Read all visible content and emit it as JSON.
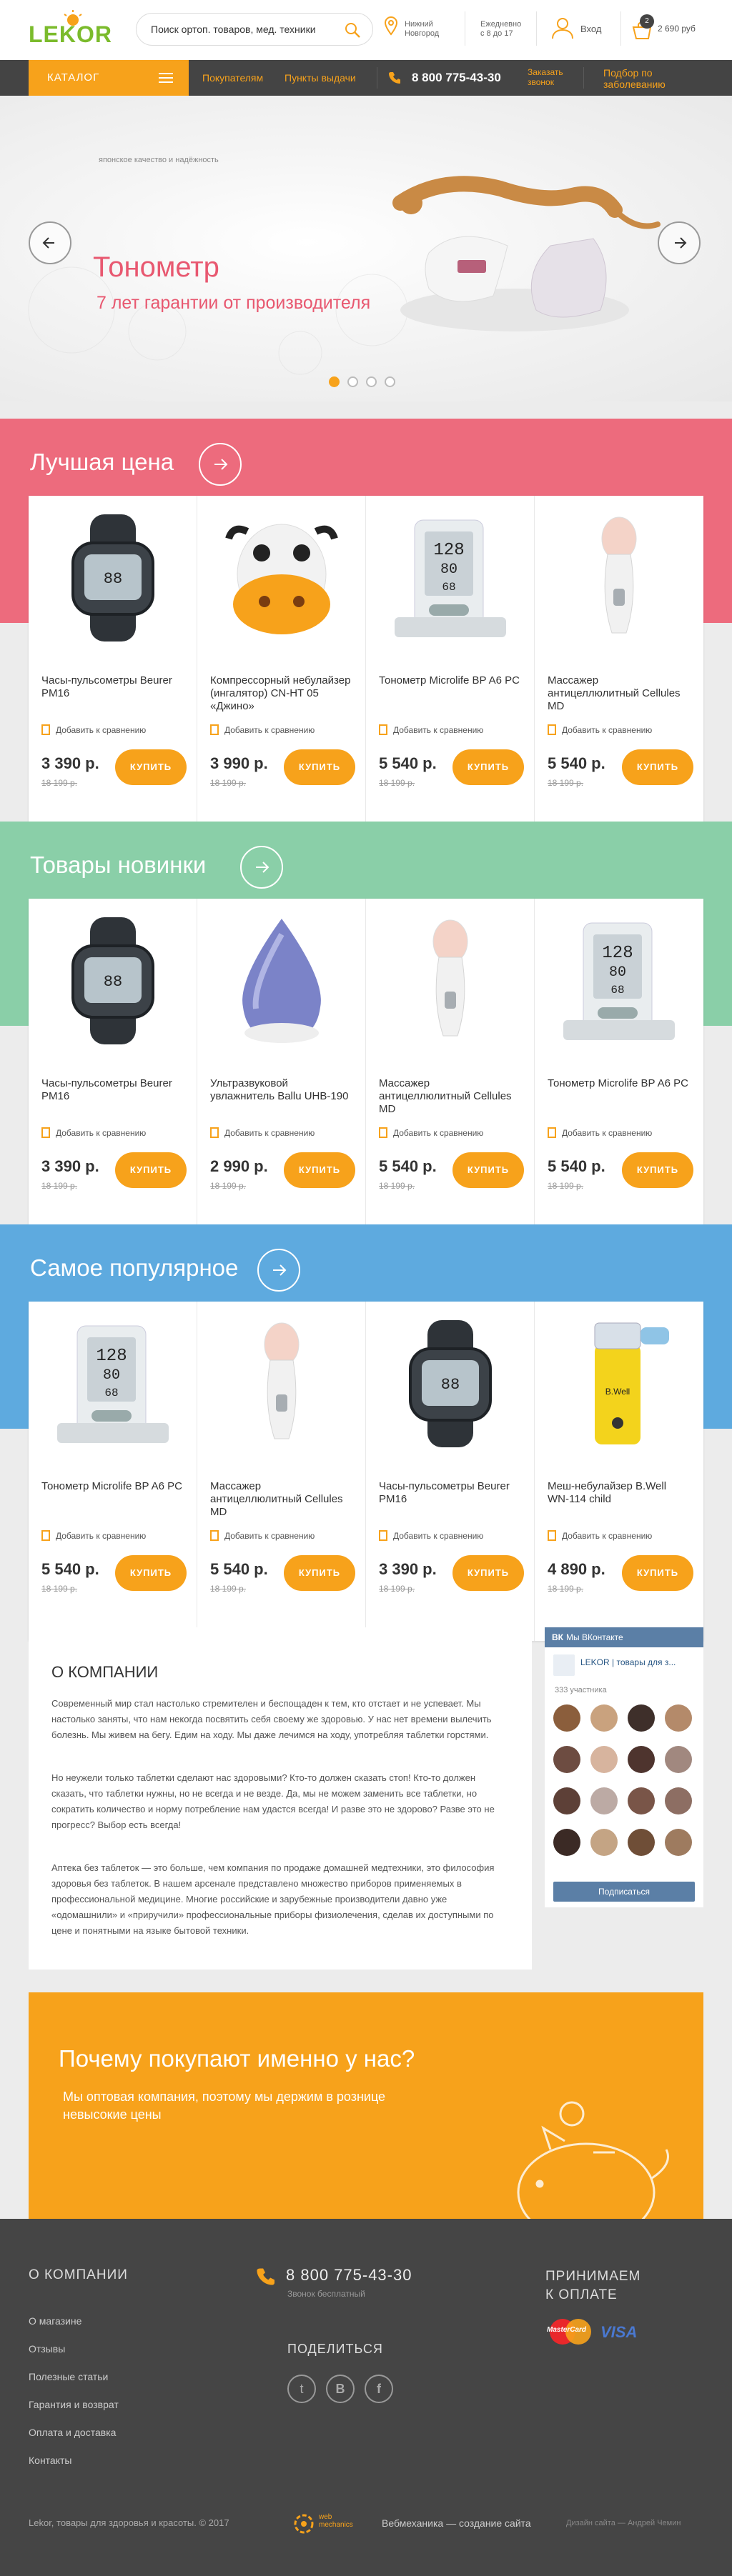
{
  "header": {
    "logo": "LEKOR",
    "search_placeholder": "Поиск ортоп. товаров, мед. техники",
    "city_line1": "Нижний",
    "city_line2": "Новгород",
    "hours_line1": "Ежедневно",
    "hours_line2": "с 8 до 17",
    "login": "Вход",
    "cart_count": "2",
    "cart_total": "2 690 руб"
  },
  "nav": {
    "catalog": "КАТАЛОГ",
    "buyers": "Покупателям",
    "pickup": "Пункты выдачи",
    "phone": "8 800 775-43-30",
    "callback_line1": "Заказать",
    "callback_line2": "звонок",
    "pick_line1": "Подбор по",
    "pick_line2": "заболеванию"
  },
  "hero": {
    "tagline": "японское качество и надёжность",
    "title": "Тонометр",
    "subtitle": "7 лет гарантии от производителя",
    "active_slide": 1,
    "slides": 4
  },
  "compare_label": "Добавить к сравнению",
  "buy_label": "КУПИТЬ",
  "sections": [
    {
      "title": "Лучшая цена",
      "color": "#ed6b7d",
      "products": [
        {
          "name": "Часы-пульсометры Beurer PM16",
          "price": "3 390 р.",
          "old": "18 199 р.",
          "icon": "watch"
        },
        {
          "name": "Компрессорный небулайзер (ингалятор) CN-HT 05 «Джино»",
          "price": "3 990 р.",
          "old": "18 199 р.",
          "icon": "cow-nebulizer"
        },
        {
          "name": "Тонометр Microlife BP A6 PC",
          "price": "5 540 р.",
          "old": "18 199 р.",
          "icon": "tonometer"
        },
        {
          "name": "Массажер антицеллюлитный Cellules MD",
          "price": "5 540 р.",
          "old": "18 199 р.",
          "icon": "massager"
        }
      ]
    },
    {
      "title": "Товары новинки",
      "color": "#8acfa8",
      "products": [
        {
          "name": "Часы-пульсометры Beurer PM16",
          "price": "3 390 р.",
          "old": "18 199 р.",
          "icon": "watch"
        },
        {
          "name": "Ультразвуковой увлажнитель Ballu UHB-190",
          "price": "2 990 р.",
          "old": "18 199 р.",
          "icon": "humidifier"
        },
        {
          "name": "Массажер антицеллюлитный Cellules MD",
          "price": "5 540 р.",
          "old": "18 199 р.",
          "icon": "massager"
        },
        {
          "name": "Тонометр Microlife BP A6 PC",
          "price": "5 540 р.",
          "old": "18 199 р.",
          "icon": "tonometer"
        }
      ]
    },
    {
      "title": "Самое популярное",
      "color": "#5eaadf",
      "products": [
        {
          "name": "Тонометр Microlife BP A6 PC",
          "price": "5 540 р.",
          "old": "18 199 р.",
          "icon": "tonometer"
        },
        {
          "name": "Массажер антицеллюлитный Cellules MD",
          "price": "5 540 р.",
          "old": "18 199 р.",
          "icon": "massager"
        },
        {
          "name": "Часы-пульсометры Beurer PM16",
          "price": "3 390 р.",
          "old": "18 199 р.",
          "icon": "watch"
        },
        {
          "name": "Меш-небулайзер B.Well WN-114 child",
          "price": "4 890 р.",
          "old": "18 199 р.",
          "icon": "mesh-nebulizer"
        }
      ]
    }
  ],
  "about": {
    "title": "О КОМПАНИИ",
    "p1": "Современный мир стал настолько стремителен и беспощаден к тем, кто отстает и не успевает. Мы настолько заняты, что нам некогда посвятить себя своему же здоровью. У нас нет времени вылечить болезнь. Мы живем на бегу. Едим на ходу. Мы даже лечимся на ходу, употребляя таблетки горстями.",
    "p2": "Но неужели только таблетки сделают нас здоровыми? Кто-то должен сказать стоп! Кто-то должен сказать, что таблетки нужны, но не всегда и не везде. Да, мы не можем заменить все таблетки, но сократить количество и норму потребление нам удастся всегда! И разве это не здорово? Разве это не прогресс? Выбор есть всегда!",
    "p3": "Аптека без таблеток — это больше, чем компания по продаже домашней медтехники, это философия здоровья без таблеток. В нашем арсенале представлено множество приборов применяемых в профессиональной медицине. Многие российские и зарубежные производители давно уже «одомашнили» и «приручили» профессиональные приборы физиолечения, сделав их доступными по цене и понятными на языке бытовой техники."
  },
  "vk": {
    "header": "Мы ВКонтакте",
    "group": "LEKOR | товары для з...",
    "members": "333 участника",
    "subscribe": "Подписаться"
  },
  "why": {
    "title": "Почему покупают именно у нас?",
    "text": "Мы оптовая компания, поэтому мы держим в рознице невысокие цены"
  },
  "footer": {
    "about_title": "О КОМПАНИИ",
    "links": [
      "О магазине",
      "Отзывы",
      "Полезные статьи",
      "Гарантия и возврат",
      "Оплата и доставка",
      "Контакты"
    ],
    "phone": "8 800 775-43-30",
    "phone_note": "Звонок бесплатный",
    "share": "ПОДЕЛИТЬСЯ",
    "pay_line1": "ПРИНИМАЕМ",
    "pay_line2": "К ОПЛАТЕ",
    "mastercard": "MasterCard",
    "visa": "VISA",
    "copyright": "Lekor, товары для здоровья и красоты. © 2017",
    "dev_logo_line1": "web",
    "dev_logo_line2": "mechanics",
    "dev": "Вебмеханика — создание сайта",
    "design": "Дизайн сайта — Андрей Чемин"
  },
  "colors": {
    "accent": "#f7a21b",
    "dark": "#444444",
    "logo_green": "#7bbb2c",
    "hero_text": "#e85870"
  }
}
